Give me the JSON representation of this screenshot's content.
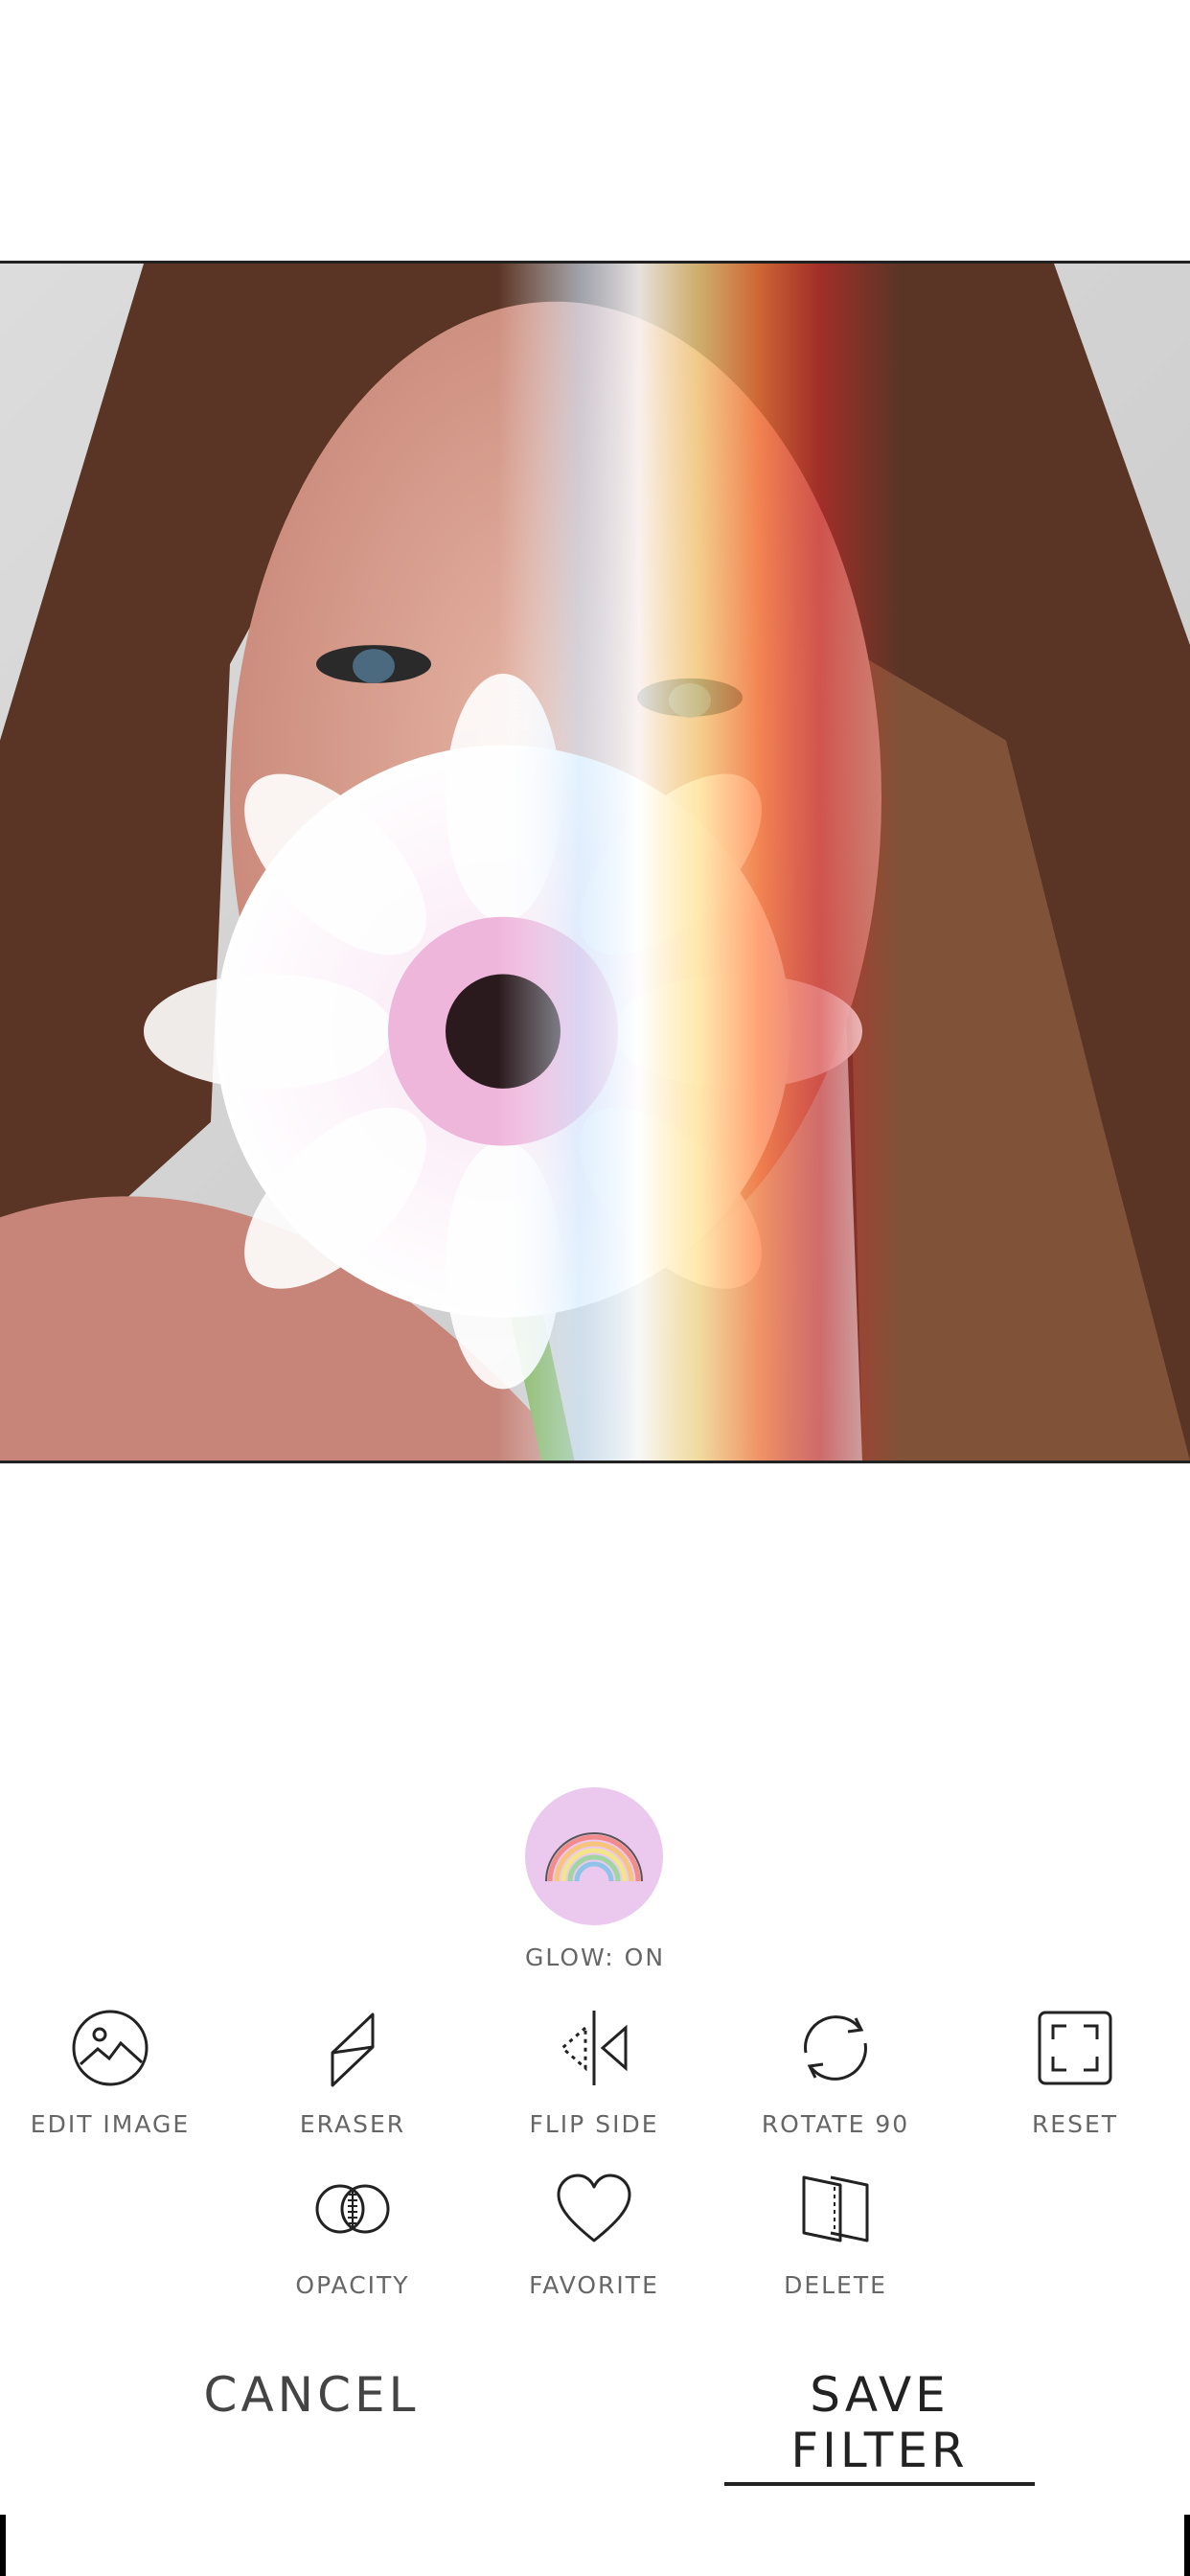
{
  "photo": {
    "description_icon": "selfie-with-flower-photo"
  },
  "glow": {
    "label": "GLOW: ON",
    "icon": "rainbow-icon",
    "bg": "#ebc8ee"
  },
  "tools_row1": [
    {
      "label": "EDIT IMAGE",
      "icon": "image-icon"
    },
    {
      "label": "ERASER",
      "icon": "eraser-icon"
    },
    {
      "label": "FLIP SIDE",
      "icon": "flip-icon"
    },
    {
      "label": "ROTATE 90",
      "icon": "rotate-icon"
    },
    {
      "label": "RESET",
      "icon": "reset-frame-icon"
    }
  ],
  "tools_row2": [
    {
      "label": "OPACITY",
      "icon": "opacity-icon"
    },
    {
      "label": "FAVORITE",
      "icon": "heart-icon"
    },
    {
      "label": "DELETE",
      "icon": "delete-icon"
    }
  ],
  "actions": {
    "cancel": "CANCEL",
    "save": "SAVE FILTER"
  }
}
